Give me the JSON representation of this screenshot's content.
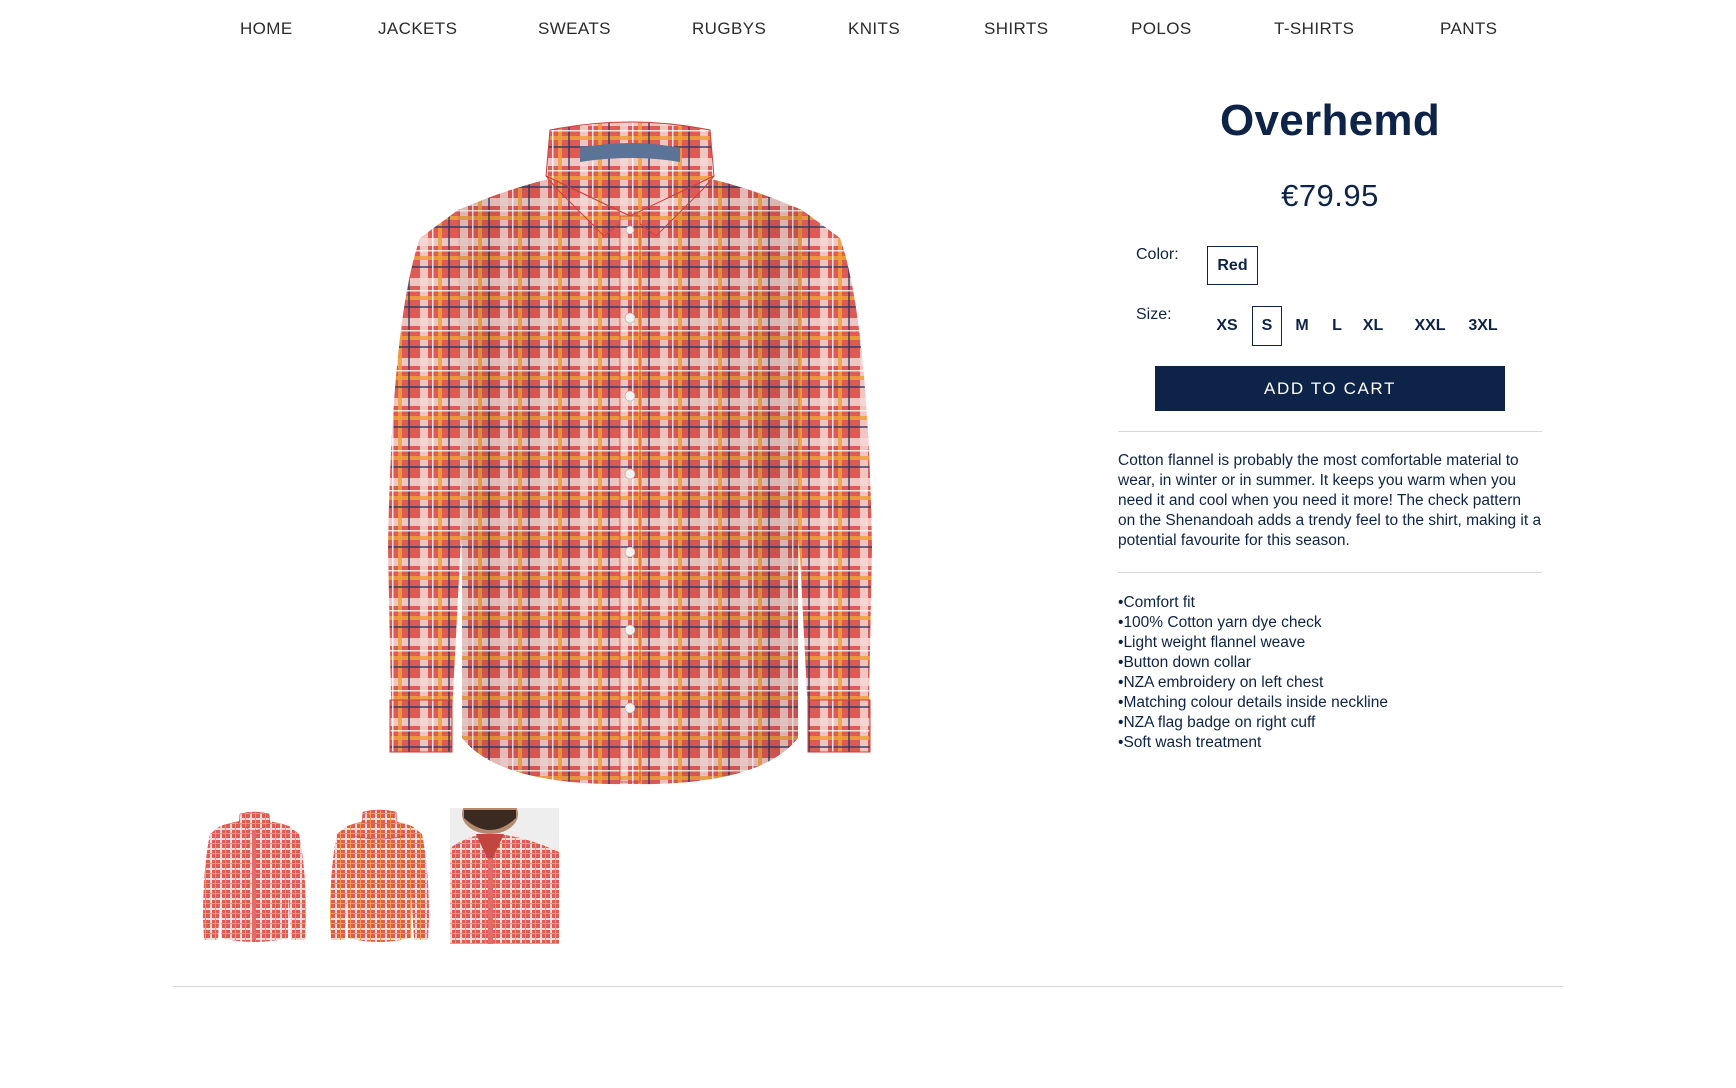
{
  "nav": {
    "items": [
      {
        "label": "HOME"
      },
      {
        "label": "JACKETS"
      },
      {
        "label": "SWEATS"
      },
      {
        "label": "RUGBYS"
      },
      {
        "label": "KNITS"
      },
      {
        "label": "SHIRTS"
      },
      {
        "label": "POLOS"
      },
      {
        "label": "T-SHIRTS"
      },
      {
        "label": "PANTS"
      }
    ]
  },
  "product": {
    "title": "Overhemd",
    "price": "€79.95",
    "color_label": "Color:",
    "color_value": "Red",
    "size_label": "Size:",
    "sizes": [
      {
        "label": "XS"
      },
      {
        "label": "S",
        "selected": true
      },
      {
        "label": "M"
      },
      {
        "label": "L"
      },
      {
        "label": "XL"
      },
      {
        "label": "XXL"
      },
      {
        "label": "3XL"
      }
    ],
    "add_to_cart_label": "ADD TO CART",
    "description": "Cotton flannel is probably the most comfortable material to wear, in winter or in summer. It keeps you warm when you need it and cool when you need it more! The check pattern on the Shenandoah adds a trendy feel to the shirt, making it a potential favourite for this season.",
    "features": [
      "Comfort fit",
      "100% Cotton yarn dye check",
      "Light weight flannel weave",
      "Button down collar",
      "NZA embroidery on left chest",
      "Matching colour details inside neckline",
      "NZA flag badge on right cuff",
      "Soft wash treatment"
    ]
  },
  "colors": {
    "brand_navy": "#0d2347",
    "shirt_red": "#d8504a",
    "check_orange": "#f0a13c",
    "check_navy": "#2c3a66"
  },
  "icons": {
    "main_image": "checked-shirt-front-image",
    "thumbnails": [
      "shirt-front-thumbnail",
      "shirt-back-thumbnail",
      "shirt-model-closeup-thumbnail"
    ]
  }
}
